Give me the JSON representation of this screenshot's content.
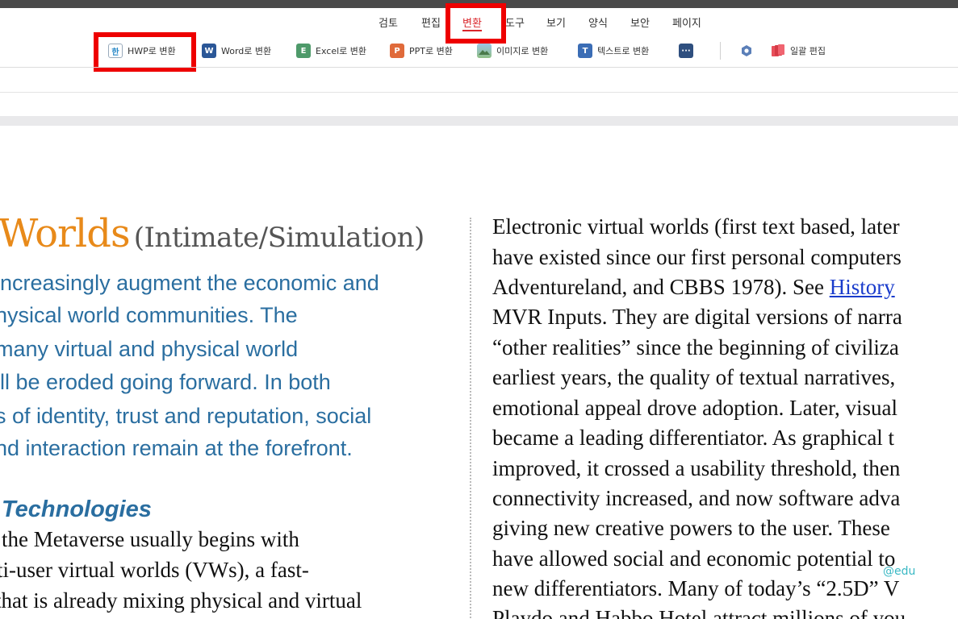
{
  "menu": {
    "items": [
      "검토",
      "편집",
      "변환",
      "도구",
      "보기",
      "양식",
      "보안",
      "페이지"
    ],
    "active": "변환"
  },
  "toolbar": {
    "hwp": "HWP로 변환",
    "word": "Word로 변환",
    "excel": "Excel로 변환",
    "ppt": "PPT로 변환",
    "image": "이미지로 변환",
    "text": "텍스트로 변환",
    "batch": "일괄 편집",
    "icons": {
      "hwp": "hwp-file-icon",
      "word": "word-icon",
      "excel": "excel-icon",
      "ppt": "powerpoint-icon",
      "image": "image-icon",
      "text": "text-icon",
      "more": "more-icon",
      "settings": "hexagon-settings-icon",
      "batch": "batch-edit-icon"
    }
  },
  "document": {
    "title": "Worlds",
    "subtitle": "(Intimate/Simulation)",
    "left_blue_lines": [
      " increasingly augment the economic and",
      "hysical world communities. The",
      "many virtual and physical world",
      "ill be eroded going forward. In both",
      "s of identity, trust and reputation, social",
      "nd interaction remain at the forefront."
    ],
    "section_heading": "Technologies",
    "left_body_lines": [
      "the Metaverse usually begins with",
      "ti-user virtual worlds (VWs), a fast-",
      "that is already mixing physical and virtual"
    ],
    "right_lines": [
      "Electronic virtual worlds (first text based, later",
      "have existed since our first personal computers",
      "MVR Inputs. They are digital versions of narra",
      "“other realities” since the beginning of civiliza",
      "earliest years, the quality of textual narratives,",
      "emotional appeal drove adoption. Later, visual",
      "became a leading differentiator. As graphical t",
      "improved, it crossed a usability threshold, then",
      "connectivity increased, and now software adva",
      "giving new creative powers to the user. These",
      "have allowed social and economic potential to",
      "new differentiators. Many of today’s “2.5D” V",
      "Playdo and Habbo Hotel attract millions of you"
    ],
    "right_line3_prefix": "Adventureland, and CBBS 1978). See ",
    "right_line3_link": "History"
  },
  "watermark": "@edu",
  "colors": {
    "accent": "#d9252a",
    "title": "#e88a1a",
    "blue_text": "#2a6ea0",
    "link": "#1a3ccc",
    "highlight_box": "#ee0000"
  }
}
